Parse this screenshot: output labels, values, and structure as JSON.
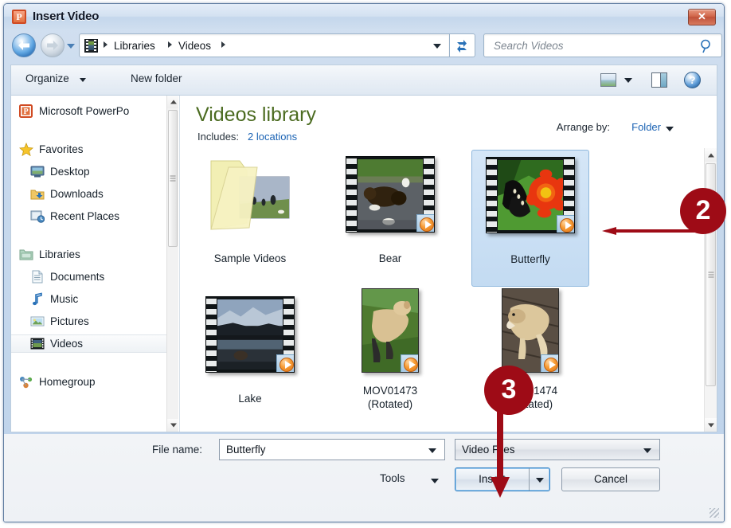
{
  "window": {
    "title": "Insert Video",
    "app_icon": "powerpoint-icon",
    "close_label": "✕"
  },
  "nav": {
    "back_icon": "back-arrow-icon",
    "forward_icon": "forward-arrow-icon",
    "recent_dropdown_icon": "chevron-down-icon",
    "path_icon": "videos-library-icon",
    "breadcrumbs": [
      "Libraries",
      "Videos"
    ],
    "address_dropdown_icon": "chevron-down-icon",
    "refresh_icon": "refresh-icon",
    "search_placeholder": "Search Videos",
    "search_icon": "search-icon"
  },
  "toolbar": {
    "organize_label": "Organize",
    "new_folder_label": "New folder",
    "view_icon": "view-mode-icon",
    "view_caret_icon": "chevron-down-icon",
    "preview_pane_icon": "preview-pane-icon",
    "help_label": "?",
    "help_icon": "help-icon"
  },
  "sidebar": {
    "items": [
      {
        "label": "Microsoft PowerPo",
        "icon": "powerpoint-icon",
        "indent": false,
        "selected": false,
        "group": false
      },
      {
        "label": "Favorites",
        "icon": "star-icon",
        "indent": false,
        "selected": false,
        "group": true
      },
      {
        "label": "Desktop",
        "icon": "desktop-icon",
        "indent": true,
        "selected": false,
        "group": false
      },
      {
        "label": "Downloads",
        "icon": "downloads-icon",
        "indent": true,
        "selected": false,
        "group": false
      },
      {
        "label": "Recent Places",
        "icon": "recent-places-icon",
        "indent": true,
        "selected": false,
        "group": false
      },
      {
        "label": "Libraries",
        "icon": "libraries-icon",
        "indent": false,
        "selected": false,
        "group": true
      },
      {
        "label": "Documents",
        "icon": "documents-icon",
        "indent": true,
        "selected": false,
        "group": false
      },
      {
        "label": "Music",
        "icon": "music-note-icon",
        "indent": true,
        "selected": false,
        "group": false
      },
      {
        "label": "Pictures",
        "icon": "pictures-icon",
        "indent": true,
        "selected": false,
        "group": false
      },
      {
        "label": "Videos",
        "icon": "videos-icon",
        "indent": true,
        "selected": true,
        "group": false
      },
      {
        "label": "Homegroup",
        "icon": "homegroup-icon",
        "indent": false,
        "selected": false,
        "group": true
      }
    ],
    "scrollbar": {
      "up_icon": "scroll-up-icon",
      "down_icon": "scroll-down-icon"
    }
  },
  "library": {
    "title": "Videos library",
    "includes_label": "Includes:",
    "includes_link": "2 locations",
    "arrange_label": "Arrange by:",
    "arrange_value": "Folder",
    "arrange_caret_icon": "chevron-down-icon"
  },
  "files": [
    {
      "name": "Sample Videos",
      "type": "folder",
      "selected": false
    },
    {
      "name": "Bear",
      "type": "video-filmstrip",
      "selected": false
    },
    {
      "name": "Butterfly",
      "type": "video-filmstrip",
      "selected": true
    },
    {
      "name": "Lake",
      "type": "video-filmstrip",
      "selected": false
    },
    {
      "name": "MOV01473\n(Rotated)",
      "type": "video-portrait",
      "selected": false
    },
    {
      "name": "MOV01474\n(Rotated)",
      "type": "video-portrait",
      "selected": false
    }
  ],
  "list_scrollbar": {
    "up_icon": "scroll-up-icon",
    "down_icon": "scroll-down-icon"
  },
  "footer": {
    "filename_label": "File name:",
    "filename_value": "Butterfly",
    "filename_caret_icon": "chevron-down-icon",
    "filetype_value": "Video Files",
    "filetype_caret_icon": "chevron-down-icon",
    "tools_label": "Tools",
    "tools_caret_icon": "chevron-down-icon",
    "insert_label": "Insert",
    "insert_split_caret_icon": "chevron-down-icon",
    "cancel_label": "Cancel",
    "resize_grip_icon": "resize-grip-icon"
  },
  "callouts": [
    {
      "number": "2",
      "points_to": "Butterfly",
      "direction": "left"
    },
    {
      "number": "3",
      "points_to": "Insert",
      "direction": "down"
    }
  ],
  "colors": {
    "callout_red": "#9e0b16",
    "library_title_green": "#4b6b20",
    "link_blue": "#1b63b4",
    "selection_blue": "#c3dbf2",
    "accent_button_border": "#2f7fc4"
  }
}
